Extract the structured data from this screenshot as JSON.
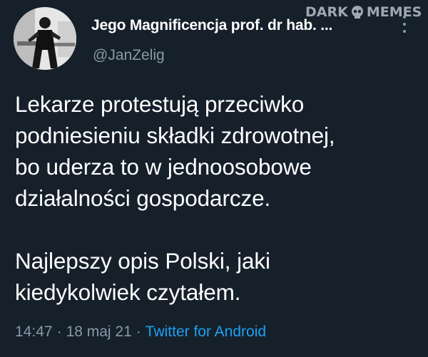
{
  "tweet": {
    "display_name": "Jego Magnificencja prof. dr hab. ...",
    "handle": "@JanZelig",
    "paragraphs": [
      "Lekarze protestują przeciwko\npodniesieniu składki zdrowotnej,\nbo uderza to w jednoosobowe\ndziałalności gospodarcze.",
      "Najlepszy opis Polski, jaki\nkiedykolwiek czytałem."
    ],
    "time": "14:47",
    "date": "18 maj 21",
    "separator": "·",
    "source": "Twitter for Android"
  },
  "watermark": {
    "text_left": "DARK",
    "text_right": "MEMES"
  },
  "icons": {
    "avatar": "profile-photo",
    "more": "more-options-icon"
  },
  "colors": {
    "background": "#15202b",
    "text_primary": "#ffffff",
    "text_secondary": "#8899a6",
    "link": "#1da1f2"
  }
}
